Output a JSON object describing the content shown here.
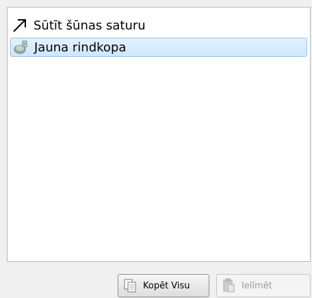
{
  "list": {
    "items": [
      {
        "label": "Sūtīt šūnas saturu",
        "icon": "arrow-up-right-icon",
        "selected": false
      },
      {
        "label": "Jauna rindkopa",
        "icon": "paragraph-icon",
        "selected": true
      }
    ]
  },
  "buttons": {
    "copy_all": "Kopēt Visu",
    "paste": "Ielīmēt"
  },
  "colors": {
    "selection_bg": "#cfe6fb",
    "selection_border": "#8fc1ea"
  }
}
